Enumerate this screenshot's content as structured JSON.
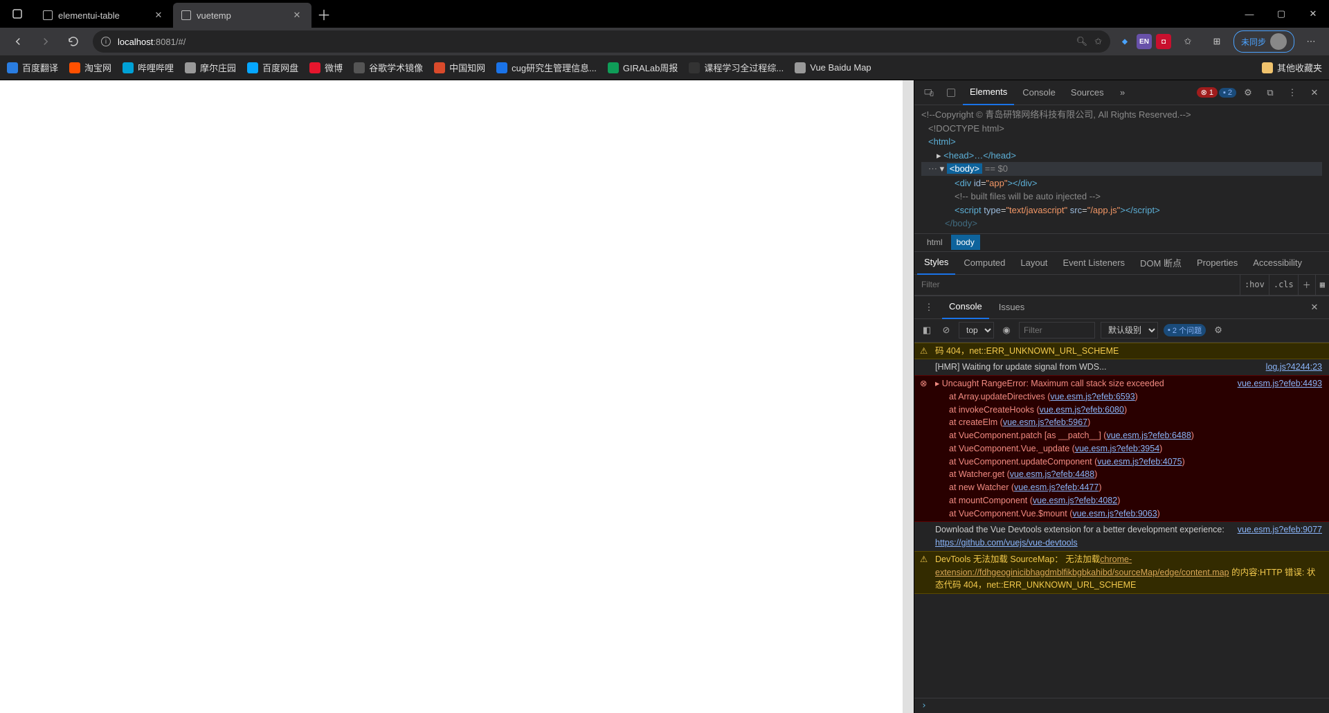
{
  "titlebar": {
    "tabs": [
      {
        "title": "elementui-table",
        "active": false
      },
      {
        "title": "vuetemp",
        "active": true
      }
    ]
  },
  "toolbar": {
    "url_host": "localhost",
    "url_port": ":8081",
    "url_path": "/#/",
    "sync_label": "未同步"
  },
  "bookmarks": {
    "items": [
      {
        "label": "百度翻译",
        "color": "#2a7de1"
      },
      {
        "label": "淘宝网",
        "color": "#ff5000"
      },
      {
        "label": "哔哩哔哩",
        "color": "#00a1d6"
      },
      {
        "label": "摩尔庄园",
        "color": "#999"
      },
      {
        "label": "百度网盘",
        "color": "#06a7ff"
      },
      {
        "label": "微博",
        "color": "#e6162d"
      },
      {
        "label": "谷歌学术镜像",
        "color": "#555"
      },
      {
        "label": "中国知网",
        "color": "#d94a2b"
      },
      {
        "label": "cug研究生管理信息...",
        "color": "#1a73e8"
      },
      {
        "label": "GIRALab周报",
        "color": "#0f9d58"
      },
      {
        "label": "课程学习全过程综...",
        "color": "#333"
      },
      {
        "label": "Vue Baidu Map",
        "color": "#999"
      }
    ],
    "other": "其他收藏夹"
  },
  "devtools": {
    "tabs": [
      "Elements",
      "Console",
      "Sources"
    ],
    "active_tab": "Elements",
    "err_count": "1",
    "issue_count": "2",
    "dom": {
      "line1": "<!--Copyright © 青岛研锦网络科技有限公司, All Rights Reserved.-->",
      "line2": "<!DOCTYPE html>",
      "line3_open": "<html>",
      "line4": "<head>…</head>",
      "line5": "<body>",
      "line5_hint": "== $0",
      "line6_pre": "<div ",
      "line6_attr": "id",
      "line6_val": "\"app\"",
      "line6_post": "></div>",
      "line7": "<!-- built files will be auto injected -->",
      "line8_pre": "<script ",
      "line8_attr1": "type",
      "line8_val1": "\"text/javascript\"",
      "line8_attr2": "src",
      "line8_val2": "\"/app.js\"",
      "line8_post": "></scr",
      "line8_post2": "ipt>",
      "line9": "</body>"
    },
    "crumbs": [
      "html",
      "body"
    ],
    "styles_tabs": [
      "Styles",
      "Computed",
      "Layout",
      "Event Listeners",
      "DOM 断点",
      "Properties",
      "Accessibility"
    ],
    "filter_placeholder": "Filter",
    "hov": ":hov",
    "cls": ".cls",
    "drawer_tabs": [
      "Console",
      "Issues"
    ],
    "console_context": "top",
    "console_filter_placeholder": "Filter",
    "console_level": "默认级别",
    "console_issues_label": "2 个问题"
  },
  "console": {
    "line_warn1": "码 404，net::ERR_UNKNOWN_URL_SCHEME",
    "line_hmr": "[HMR] Waiting for update signal from WDS...",
    "line_hmr_link": "log.js?4244:23",
    "err_head": "Uncaught RangeError: Maximum call stack size exceeded",
    "err_link": "vue.esm.js?efeb:4493",
    "stack": [
      {
        "t": "at Array.updateDirectives (",
        "l": "vue.esm.js?efeb:6593",
        "s": ")"
      },
      {
        "t": "at invokeCreateHooks (",
        "l": "vue.esm.js?efeb:6080",
        "s": ")"
      },
      {
        "t": "at createElm (",
        "l": "vue.esm.js?efeb:5967",
        "s": ")"
      },
      {
        "t": "at VueComponent.patch [as __patch__] (",
        "l": "vue.esm.js?efeb:6488",
        "s": ")"
      },
      {
        "t": "at VueComponent.Vue._update (",
        "l": "vue.esm.js?efeb:3954",
        "s": ")"
      },
      {
        "t": "at VueComponent.updateComponent (",
        "l": "vue.esm.js?efeb:4075",
        "s": ")"
      },
      {
        "t": "at Watcher.get (",
        "l": "vue.esm.js?efeb:4488",
        "s": ")"
      },
      {
        "t": "at new Watcher (",
        "l": "vue.esm.js?efeb:4477",
        "s": ")"
      },
      {
        "t": "at mountComponent (",
        "l": "vue.esm.js?efeb:4082",
        "s": ")"
      },
      {
        "t": "at VueComponent.Vue.$mount (",
        "l": "vue.esm.js?efeb:9063",
        "s": ")"
      }
    ],
    "devtools_msg": "Download the Vue Devtools extension for a better development experience:",
    "devtools_link": "https://github.com/vuejs/vue-devtools",
    "devtools_src": "vue.esm.js?efeb:9077",
    "warn2_pre": "DevTools 无法加载 SourceMap： 无法加载",
    "warn2_link": "chrome-extension://fdhgeoginicibhagdmblfikbgbkahibd/sourceMap/edge/content.map",
    "warn2_post": " 的内容:HTTP 错误: 状态代码 404，net::ERR_UNKNOWN_URL_SCHEME"
  }
}
